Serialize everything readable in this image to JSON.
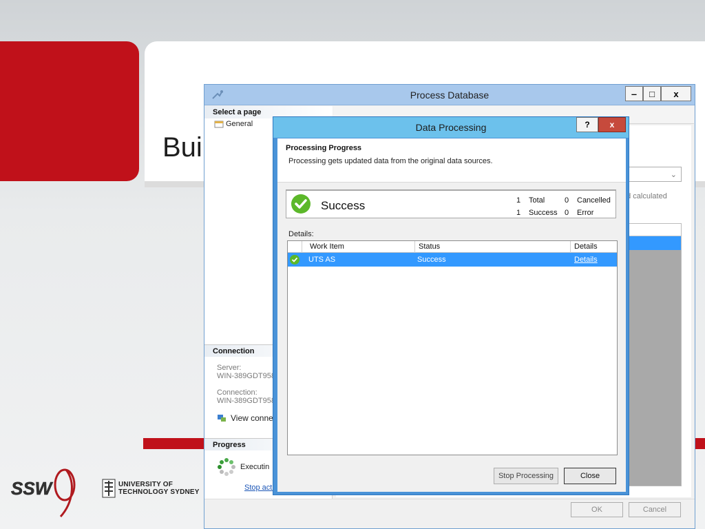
{
  "slide": {
    "title_partial": "Bui",
    "uts_logo_text": [
      "UNIVERSITY OF",
      "TECHNOLOGY SYDNEY"
    ],
    "ssw_logo_text": "SSW",
    "colors": {
      "brand_red": "#c0111a"
    }
  },
  "process_database": {
    "title": "Process Database",
    "controls": {
      "minimize": "‒",
      "maximize": "□",
      "close": "x"
    },
    "sidebar": {
      "select_page_header": "Select a page",
      "pages": [
        {
          "label": "General"
        }
      ],
      "connection_header": "Connection",
      "server_label": "Server:",
      "server_value": "WIN-389GDT958",
      "connection_label": "Connection:",
      "connection_value": "WIN-389GDT958",
      "view_connection_label": "View connec",
      "progress_header": "Progress",
      "progress_status": "Executin",
      "stop_action_link": "Stop acti"
    },
    "content": {
      "description_partial": "nd calculated"
    },
    "footer": {
      "ok_label": "OK",
      "cancel_label": "Cancel"
    }
  },
  "data_processing": {
    "title": "Data Processing",
    "help_label": "?",
    "close_label": "x",
    "heading": "Processing Progress",
    "subheading": "Processing gets updated data from the original data sources.",
    "status": {
      "text": "Success",
      "total_count": "1",
      "total_label": "Total",
      "success_count": "1",
      "success_label": "Success",
      "cancelled_count": "0",
      "cancelled_label": "Cancelled",
      "error_count": "0",
      "error_label": "Error"
    },
    "details_label": "Details:",
    "table": {
      "columns": [
        "Work Item",
        "Status",
        "Details"
      ],
      "rows": [
        {
          "work_item": "UTS AS",
          "status": "Success",
          "details": "Details"
        }
      ]
    },
    "stop_processing_label": "Stop Processing",
    "close_button_label": "Close",
    "colors": {
      "success_green": "#5cb82a",
      "selection_blue": "#3399ff"
    }
  }
}
